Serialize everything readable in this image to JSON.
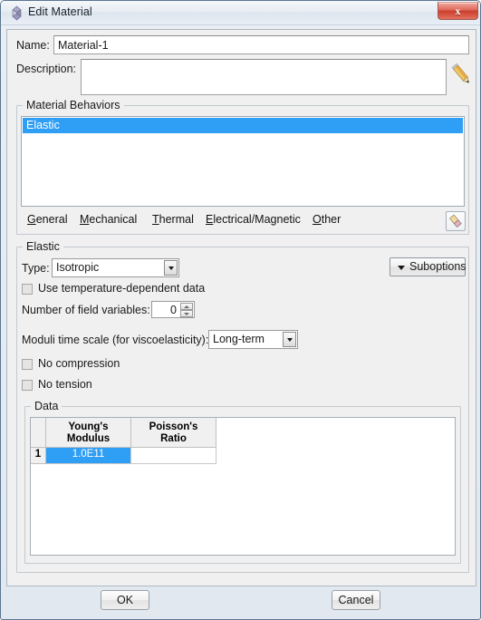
{
  "window": {
    "title": "Edit Material",
    "icon": "abaqus-diamond-icon",
    "close_label": "x",
    "accent_selection_color": "#2f9ef5",
    "close_button_color": "#cb3f2d"
  },
  "form": {
    "name_label": "Name:",
    "name_value": "Material-1",
    "description_label": "Description:",
    "description_value": "",
    "description_edit_icon": "pencil-icon"
  },
  "material_behaviors": {
    "group_title": "Material Behaviors",
    "items": [
      {
        "label": "Elastic",
        "selected": true
      }
    ],
    "menu": [
      {
        "label": "General",
        "mnemonic": "G"
      },
      {
        "label": "Mechanical",
        "mnemonic": "M"
      },
      {
        "label": "Thermal",
        "mnemonic": "T"
      },
      {
        "label": "Electrical/Magnetic",
        "mnemonic": "E"
      },
      {
        "label": "Other",
        "mnemonic": "O"
      }
    ],
    "delete_icon": "eraser-icon"
  },
  "elastic": {
    "group_title": "Elastic",
    "type_label": "Type:",
    "type_value": "Isotropic",
    "type_options": [
      "Isotropic"
    ],
    "suboptions_label": "Suboptions",
    "suboptions_icon": "triangle-down-icon",
    "use_temp_dependent_label": "Use temperature-dependent data",
    "use_temp_dependent_checked": false,
    "field_variables_label": "Number of field variables:",
    "field_variables_value": "0",
    "moduli_label": "Moduli time scale (for viscoelasticity):",
    "moduli_value": "Long-term",
    "moduli_options": [
      "Long-term"
    ],
    "no_compression_label": "No compression",
    "no_compression_checked": false,
    "no_tension_label": "No tension",
    "no_tension_checked": false
  },
  "data_table": {
    "group_title": "Data",
    "columns": [
      "Young's\nModulus",
      "Poisson's\nRatio"
    ],
    "column_line1": [
      "Young's",
      "Poisson's"
    ],
    "column_line2": [
      "Modulus",
      "Ratio"
    ],
    "rows": [
      {
        "index": "1",
        "youngs_modulus": "1.0E11",
        "poissons_ratio": "",
        "selected_cell": "youngs_modulus"
      }
    ]
  },
  "footer": {
    "ok_label": "OK",
    "cancel_label": "Cancel"
  }
}
